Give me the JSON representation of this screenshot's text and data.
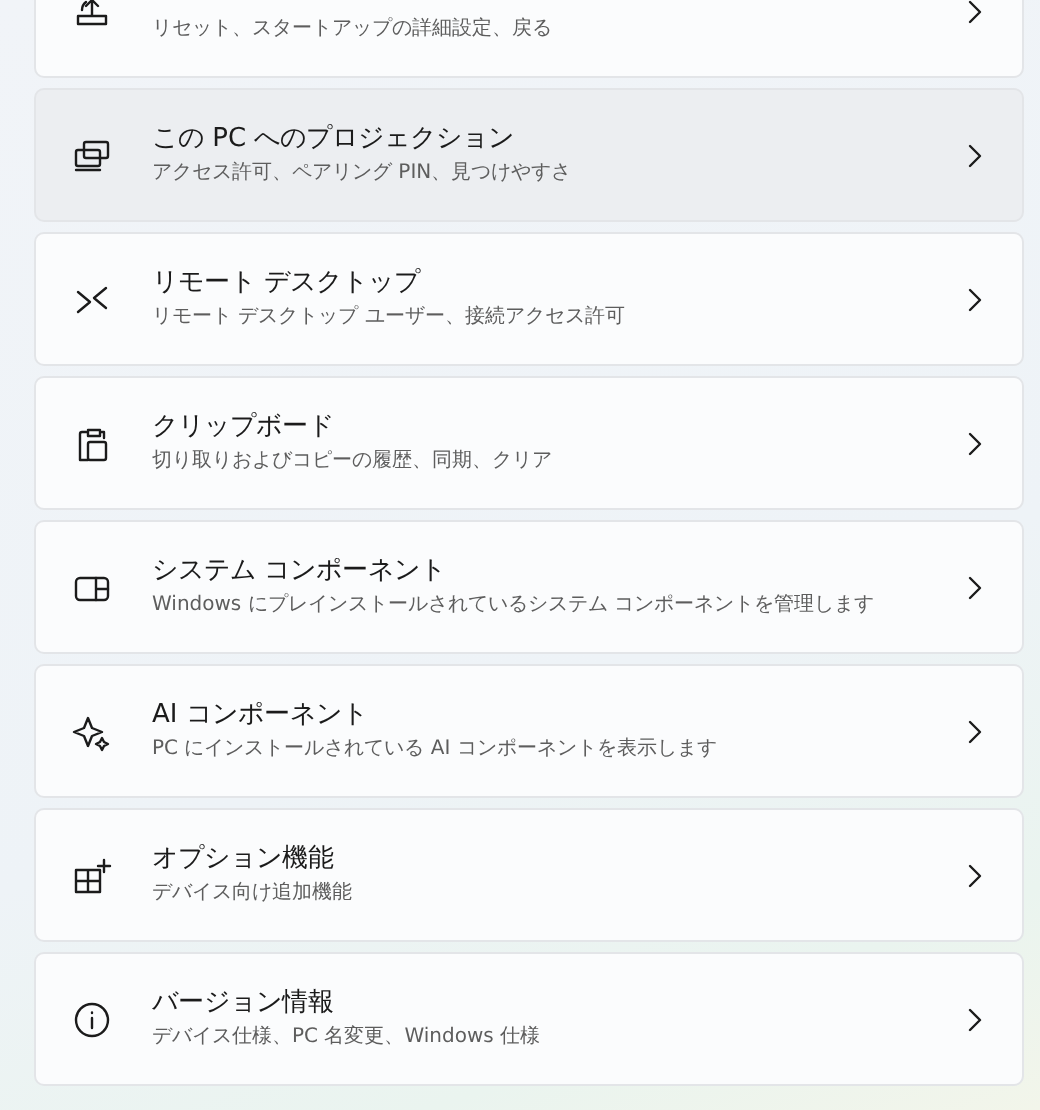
{
  "settings_items": [
    {
      "subtitle": "リセット、スタートアップの詳細設定、戻る",
      "hovered": false
    },
    {
      "title": "この PC へのプロジェクション",
      "subtitle": "アクセス許可、ペアリング PIN、見つけやすさ",
      "hovered": true
    },
    {
      "title": "リモート デスクトップ",
      "subtitle": "リモート デスクトップ ユーザー、接続アクセス許可",
      "hovered": false
    },
    {
      "title": "クリップボード",
      "subtitle": "切り取りおよびコピーの履歴、同期、クリア",
      "hovered": false
    },
    {
      "title": "システム コンポーネント",
      "subtitle": "Windows にプレインストールされているシステム コンポーネントを管理します",
      "hovered": false
    },
    {
      "title": "AI コンポーネント",
      "subtitle": "PC にインストールされている AI コンポーネントを表示します",
      "hovered": false
    },
    {
      "title": "オプション機能",
      "subtitle": "デバイス向け追加機能",
      "hovered": false
    },
    {
      "title": "バージョン情報",
      "subtitle": "デバイス仕様、PC 名変更、Windows 仕様",
      "hovered": false
    }
  ]
}
